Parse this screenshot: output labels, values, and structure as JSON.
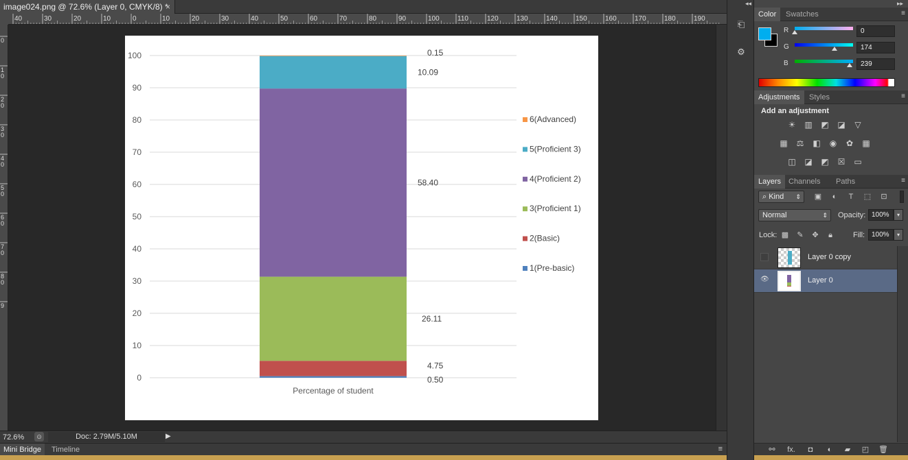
{
  "document": {
    "tab_title": "image024.png @ 72.6% (Layer 0, CMYK/8) *",
    "close_glyph": "×"
  },
  "rulers": {
    "top_labels": [
      "40",
      "30",
      "20",
      "10",
      "0",
      "10",
      "20",
      "30",
      "40",
      "50",
      "60",
      "70",
      "80",
      "90",
      "100",
      "110",
      "120",
      "130",
      "140",
      "150",
      "160",
      "170",
      "180",
      "190"
    ],
    "left_labels": [
      "0",
      "1 0",
      "2 0",
      "3 0",
      "4 0",
      "5 0",
      "6 0",
      "7 0",
      "8 0",
      "9"
    ]
  },
  "chart_data": {
    "type": "bar",
    "stacked": true,
    "categories": [
      "Percentage of student"
    ],
    "ylim": [
      0,
      100
    ],
    "yticks": [
      "0",
      "10",
      "20",
      "30",
      "40",
      "50",
      "60",
      "70",
      "80",
      "90",
      "100"
    ],
    "series": [
      {
        "name": "1(Pre-basic)",
        "values": [
          0.5
        ],
        "label": "0.50",
        "color": "#4f81bd"
      },
      {
        "name": "2(Basic)",
        "values": [
          4.75
        ],
        "label": "4.75",
        "color": "#c0504d"
      },
      {
        "name": "3(Proficient 1)",
        "values": [
          26.11
        ],
        "label": "26.11",
        "color": "#9bbb59"
      },
      {
        "name": "4(Proficient 2)",
        "values": [
          58.4
        ],
        "label": "58.40",
        "color": "#8064a2"
      },
      {
        "name": "5(Proficient 3)",
        "values": [
          10.09
        ],
        "label": "10.09",
        "color": "#4bacc6"
      },
      {
        "name": "6(Advanced)",
        "values": [
          0.15
        ],
        "label": "0.15",
        "color": "#f79646"
      }
    ],
    "legend_order": [
      "6(Advanced)",
      "5(Proficient 3)",
      "4(Proficient 2)",
      "3(Proficient 1)",
      "2(Basic)",
      "1(Pre-basic)"
    ],
    "legend_position": "right",
    "grid": true
  },
  "statusbar": {
    "zoom": "72.6%",
    "doc_info": "Doc: 2.79M/5.10M",
    "arrow": "▶"
  },
  "bottom_tabs": {
    "mini_bridge": "Mini Bridge",
    "timeline": "Timeline"
  },
  "color_panel": {
    "tabs": {
      "color": "Color",
      "swatches": "Swatches"
    },
    "foreground": "#00aeef",
    "background": "#000000",
    "r": {
      "label": "R",
      "value": "0",
      "fraction": 0.0
    },
    "g": {
      "label": "G",
      "value": "174",
      "fraction": 0.68
    },
    "b": {
      "label": "B",
      "value": "239",
      "fraction": 0.94
    }
  },
  "adjustments_panel": {
    "tabs": {
      "adjustments": "Adjustments",
      "styles": "Styles"
    },
    "title": "Add an adjustment",
    "icons": [
      [
        "brightness-contrast-icon",
        "levels-icon",
        "curves-icon",
        "exposure-icon",
        "vibrance-icon"
      ],
      [
        "hue-saturation-icon",
        "color-balance-icon",
        "black-white-icon",
        "photo-filter-icon",
        "channel-mixer-icon",
        "color-lookup-icon"
      ],
      [
        "invert-icon",
        "posterize-icon",
        "threshold-icon",
        "selective-color-icon",
        "gradient-map-icon"
      ]
    ]
  },
  "layers_panel": {
    "tabs": {
      "layers": "Layers",
      "channels": "Channels",
      "paths": "Paths"
    },
    "kind_label": "Kind",
    "blend_mode": "Normal",
    "opacity_label": "Opacity:",
    "opacity_value": "100%",
    "lock_label": "Lock:",
    "fill_label": "Fill:",
    "fill_value": "100%",
    "layers": [
      {
        "name": "Layer 0 copy",
        "visible": false,
        "selected": false
      },
      {
        "name": "Layer 0",
        "visible": true,
        "selected": true
      }
    ],
    "footer_fx": "fx."
  }
}
